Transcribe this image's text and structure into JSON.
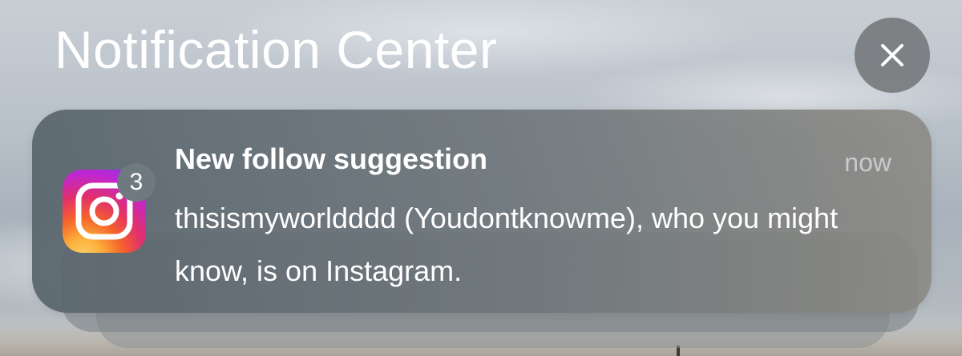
{
  "header": {
    "title": "Notification Center"
  },
  "close_button": {
    "icon": "close-icon"
  },
  "notification": {
    "app_icon": "instagram-icon",
    "badge_count": "3",
    "title": "New follow suggestion",
    "time": "now",
    "body": "thisismyworldddd (Youdontknowme), who you might know, is on Instagram."
  },
  "colors": {
    "card_background": "#5e6a70",
    "badge_background": "#6f7a80",
    "close_button_background": "#6e7073",
    "text_primary": "#ffffff",
    "text_secondary": "#dce0e4"
  }
}
